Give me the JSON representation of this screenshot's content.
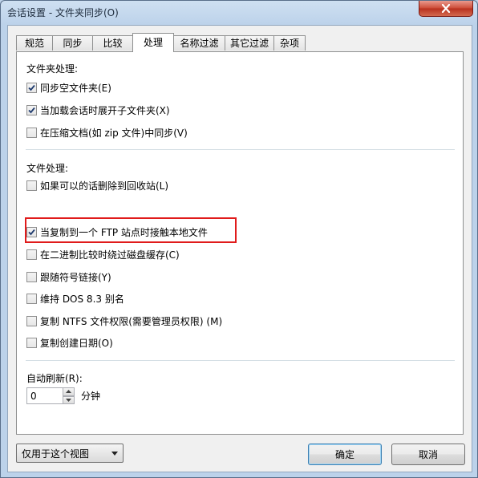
{
  "window": {
    "title": "会话设置 - 文件夹同步(O)"
  },
  "tabs": [
    {
      "label": "规范"
    },
    {
      "label": "同步"
    },
    {
      "label": "比较"
    },
    {
      "label": "处理"
    },
    {
      "label": "名称过滤"
    },
    {
      "label": "其它过滤"
    },
    {
      "label": "杂项"
    }
  ],
  "active_tab": "处理",
  "folder_section": {
    "label": "文件夹处理:",
    "items": [
      {
        "label": "同步空文件夹(E)",
        "checked": true
      },
      {
        "label": "当加载会话时展开子文件夹(X)",
        "checked": true
      },
      {
        "label": "在压缩文档(如 zip 文件)中同步(V)",
        "checked": false
      }
    ]
  },
  "file_section": {
    "label": "文件处理:",
    "items": [
      {
        "label": "如果可以的话删除到回收站(L)",
        "checked": false
      },
      {
        "label": "当复制到一个 FTP 站点时接触本地文件",
        "checked": true
      },
      {
        "label": "在二进制比较时绕过磁盘缓存(C)",
        "checked": false
      },
      {
        "label": "跟随符号链接(Y)",
        "checked": false
      },
      {
        "label": "维持 DOS 8.3 别名",
        "checked": false
      },
      {
        "label": "复制 NTFS 文件权限(需要管理员权限) (M)",
        "checked": false
      },
      {
        "label": "复制创建日期(O)",
        "checked": false
      }
    ]
  },
  "auto_refresh": {
    "label": "自动刷新(R):",
    "value": "0",
    "unit": "分钟"
  },
  "footer": {
    "scope_value": "仅用于这个视图",
    "ok_label": "确定",
    "cancel_label": "取消"
  },
  "colors": {
    "highlight": "#e01b1b",
    "close_button": "#c7432d"
  }
}
